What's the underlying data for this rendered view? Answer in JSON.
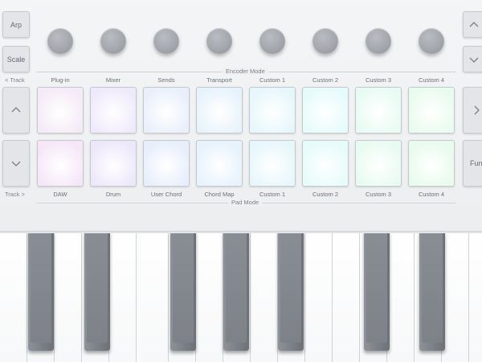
{
  "left_buttons": {
    "arp": "Arp",
    "scale": "Scale",
    "track_prev_label": "< Track",
    "track_next_label": "Track >"
  },
  "right_buttons": {
    "func": "Func"
  },
  "encoders": {
    "mode_label": "Encoder Mode",
    "labels": [
      "Plug-in",
      "Mixer",
      "Sends",
      "Transport",
      "Custom 1",
      "Custom 2",
      "Custom 3",
      "Custom 4"
    ]
  },
  "pads": {
    "mode_label": "Pad Mode",
    "labels": [
      "DAW",
      "Drum",
      "User Chord",
      "Chord Map",
      "Custom 1",
      "Custom 2",
      "Custom 3",
      "Custom 4"
    ],
    "top_row_colors": [
      "#f5eaf7",
      "#efeafb",
      "#e9effb",
      "#e7f3fb",
      "#e6f7fb",
      "#e6fbfb",
      "#e8fbf3",
      "#e9fbee"
    ],
    "bottom_row_colors": [
      "#f6e6f8",
      "#ede7fb",
      "#e7eefc",
      "#e6f2fc",
      "#e6f7fb",
      "#e6fbfa",
      "#e8fbf1",
      "#e8fbec"
    ]
  },
  "icons": {
    "up": "chevron-up-icon",
    "down": "chevron-down-icon",
    "right": "chevron-right-icon"
  }
}
